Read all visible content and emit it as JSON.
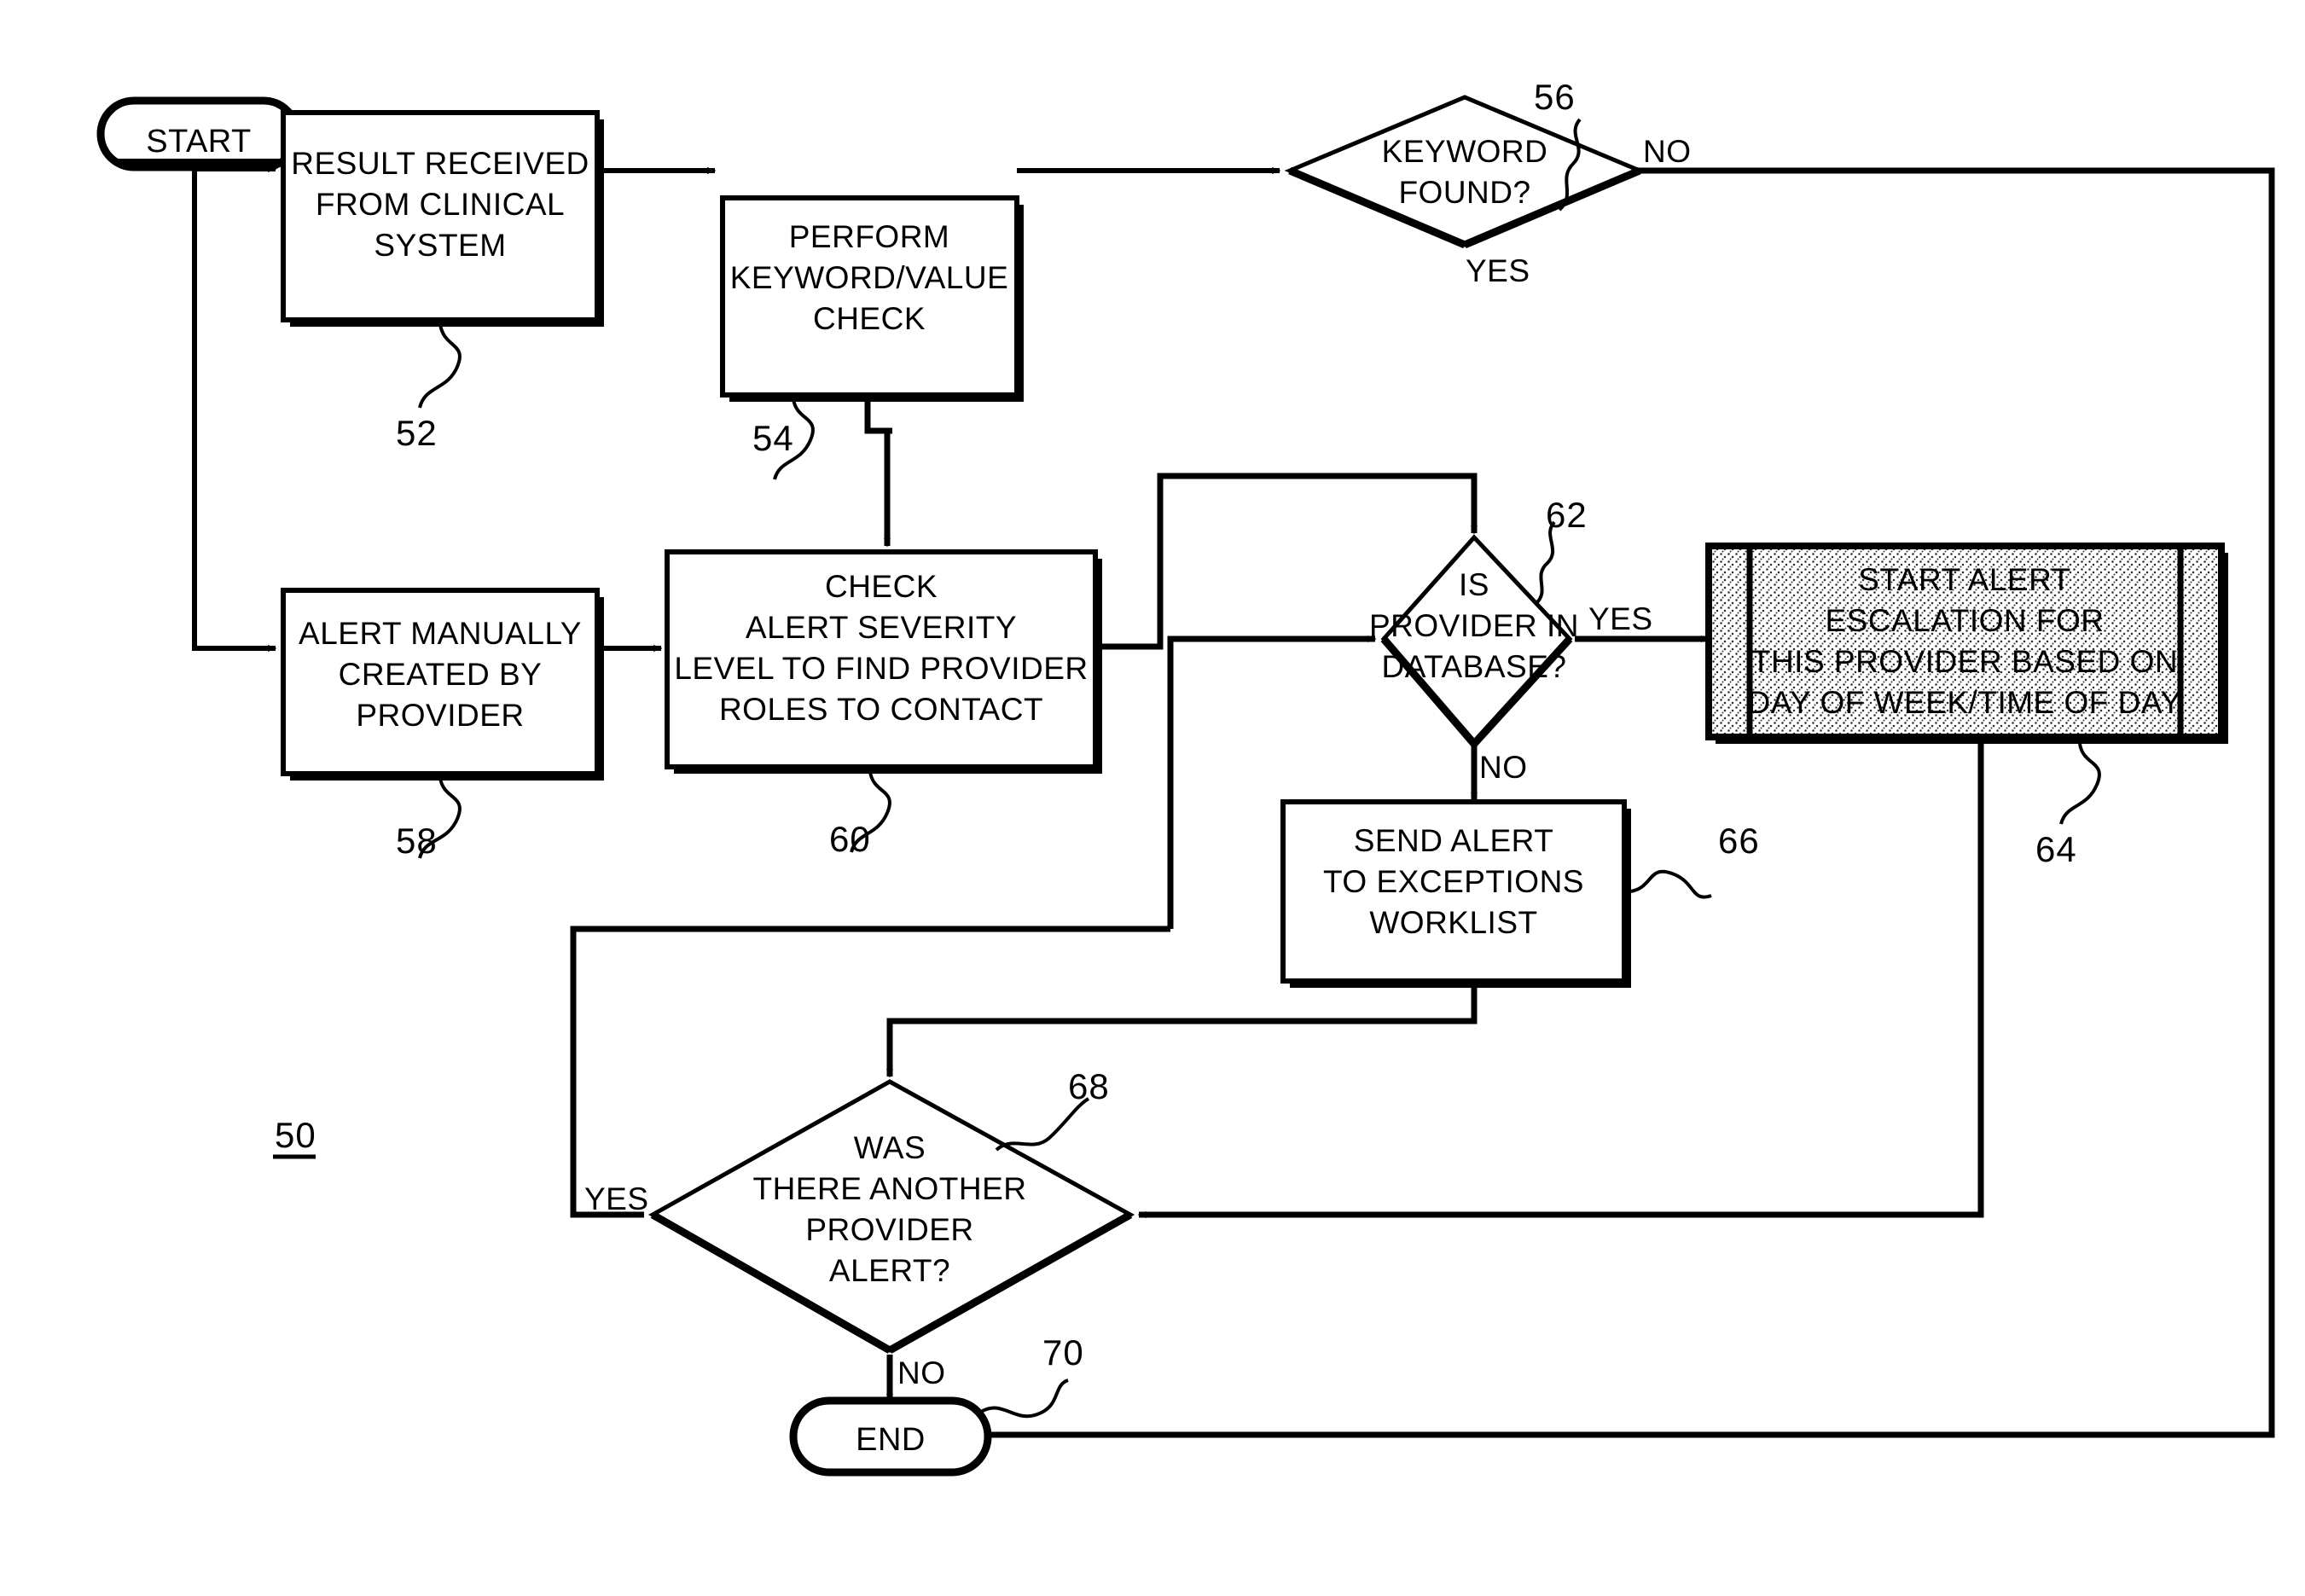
{
  "figure": {
    "figure_ref": "50",
    "title": "Alert escalation process flowchart"
  },
  "terminators": [
    {
      "id": "start",
      "label": "START"
    },
    {
      "id": "end",
      "label": "END"
    }
  ],
  "nodes": [
    {
      "id": "n52",
      "ref": "52",
      "shape": "process",
      "lines": [
        "RESULT RECEIVED",
        "FROM CLINICAL",
        "SYSTEM"
      ]
    },
    {
      "id": "n54",
      "ref": "54",
      "shape": "process",
      "lines": [
        "PERFORM",
        "KEYWORD/VALUE",
        "CHECK"
      ]
    },
    {
      "id": "n56",
      "ref": "56",
      "shape": "decision",
      "lines": [
        "KEYWORD",
        "FOUND?"
      ]
    },
    {
      "id": "n58",
      "ref": "58",
      "shape": "process",
      "lines": [
        "ALERT MANUALLY",
        "CREATED BY",
        "PROVIDER"
      ]
    },
    {
      "id": "n60",
      "ref": "60",
      "shape": "process",
      "lines": [
        "CHECK",
        "ALERT SEVERITY",
        "LEVEL TO FIND  PROVIDER",
        "ROLES TO CONTACT"
      ]
    },
    {
      "id": "n62",
      "ref": "62",
      "shape": "decision",
      "lines": [
        "IS",
        "PROVIDER IN",
        "DATABASE?"
      ]
    },
    {
      "id": "n64",
      "ref": "64",
      "shape": "predefined-process",
      "shaded": true,
      "lines": [
        "START ALERT",
        "ESCALATION FOR",
        "THIS PROVIDER BASED ON",
        "DAY OF WEEK/TIME OF DAY"
      ]
    },
    {
      "id": "n66",
      "ref": "66",
      "shape": "process",
      "lines": [
        "SEND ALERT",
        "TO EXCEPTIONS",
        "WORKLIST"
      ]
    },
    {
      "id": "n68",
      "ref": "68",
      "shape": "decision",
      "lines": [
        "WAS",
        "THERE ANOTHER",
        "PROVIDER",
        "ALERT?"
      ]
    },
    {
      "id": "n70",
      "ref": "70",
      "shape": "terminator",
      "lines": [
        "END"
      ]
    }
  ],
  "edge_labels": {
    "keyword_no": "NO",
    "keyword_yes": "YES",
    "provider_yes": "YES",
    "provider_no": "NO",
    "another_yes": "YES",
    "another_no": "NO"
  },
  "colors": {
    "line": "#000000",
    "fill": "#ffffff",
    "shaded_fill": "#d9d9d9"
  }
}
